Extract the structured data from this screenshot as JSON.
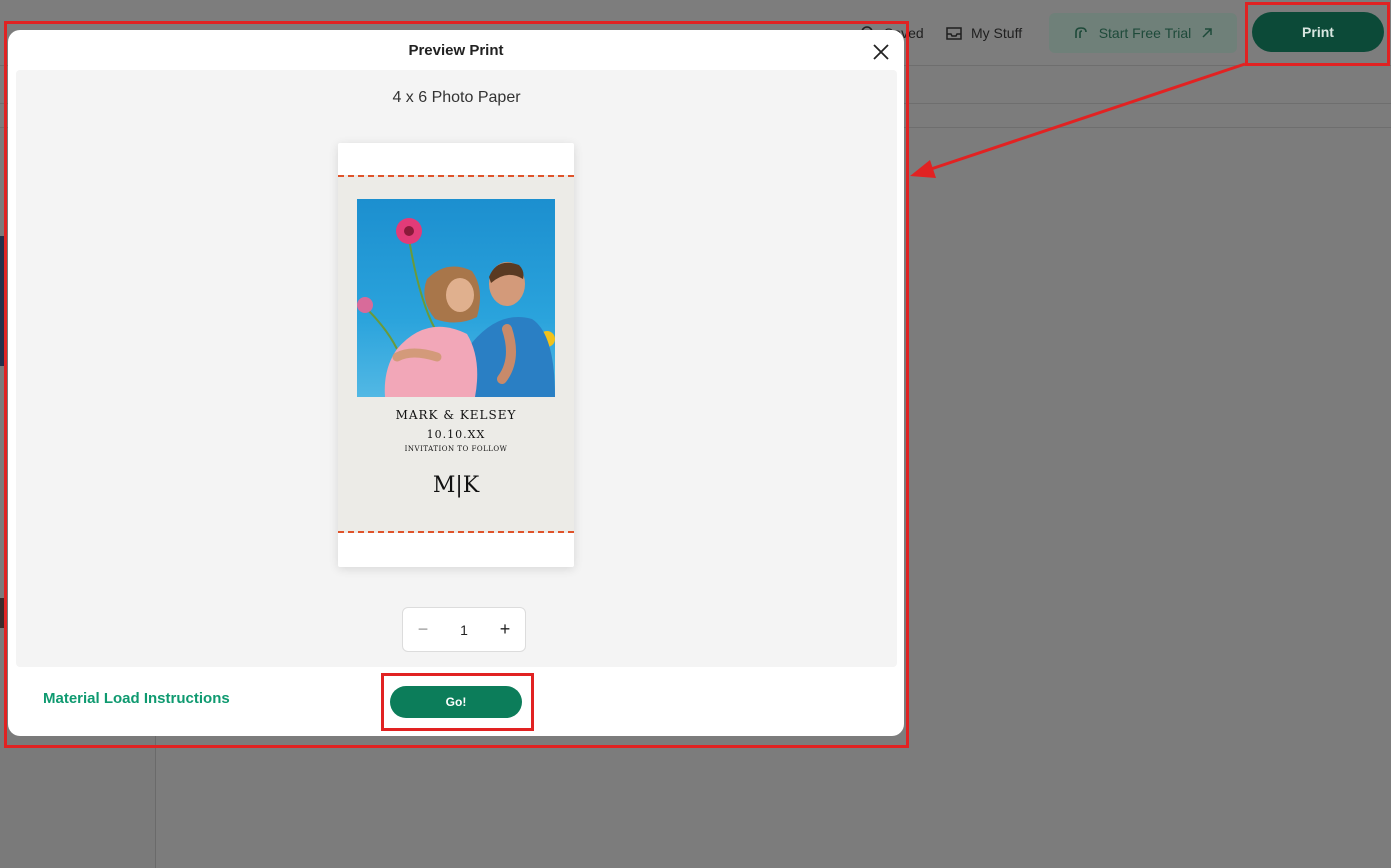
{
  "header": {
    "saved_label": "Saved",
    "mystuff_label": "My Stuff",
    "trial_label": "Start Free Trial",
    "print_label": "Print"
  },
  "modal": {
    "title": "Preview Print",
    "paper_label": "4 x 6 Photo Paper",
    "card": {
      "names": "MARK & KELSEY",
      "date": "10.10.XX",
      "follow": "INVITATION TO FOLLOW",
      "monogram": "M|K"
    },
    "quantity": {
      "minus": "−",
      "value": "1",
      "plus": "+"
    },
    "material_link": "Material Load Instructions",
    "go_label": "Go!"
  },
  "colors": {
    "accent": "#0c7d5a",
    "link": "#0f9a70",
    "annotation": "#e12222",
    "cut_line": "#e0532a"
  }
}
